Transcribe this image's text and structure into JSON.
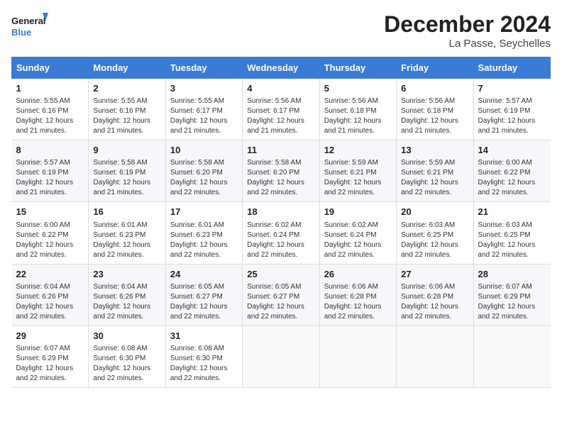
{
  "header": {
    "logo_line1": "General",
    "logo_line2": "Blue",
    "month": "December 2024",
    "location": "La Passe, Seychelles"
  },
  "columns": [
    "Sunday",
    "Monday",
    "Tuesday",
    "Wednesday",
    "Thursday",
    "Friday",
    "Saturday"
  ],
  "weeks": [
    [
      {
        "day": "1",
        "info": "Sunrise: 5:55 AM\nSunset: 6:16 PM\nDaylight: 12 hours\nand 21 minutes."
      },
      {
        "day": "2",
        "info": "Sunrise: 5:55 AM\nSunset: 6:16 PM\nDaylight: 12 hours\nand 21 minutes."
      },
      {
        "day": "3",
        "info": "Sunrise: 5:55 AM\nSunset: 6:17 PM\nDaylight: 12 hours\nand 21 minutes."
      },
      {
        "day": "4",
        "info": "Sunrise: 5:56 AM\nSunset: 6:17 PM\nDaylight: 12 hours\nand 21 minutes."
      },
      {
        "day": "5",
        "info": "Sunrise: 5:56 AM\nSunset: 6:18 PM\nDaylight: 12 hours\nand 21 minutes."
      },
      {
        "day": "6",
        "info": "Sunrise: 5:56 AM\nSunset: 6:18 PM\nDaylight: 12 hours\nand 21 minutes."
      },
      {
        "day": "7",
        "info": "Sunrise: 5:57 AM\nSunset: 6:19 PM\nDaylight: 12 hours\nand 21 minutes."
      }
    ],
    [
      {
        "day": "8",
        "info": "Sunrise: 5:57 AM\nSunset: 6:19 PM\nDaylight: 12 hours\nand 21 minutes."
      },
      {
        "day": "9",
        "info": "Sunrise: 5:58 AM\nSunset: 6:19 PM\nDaylight: 12 hours\nand 21 minutes."
      },
      {
        "day": "10",
        "info": "Sunrise: 5:58 AM\nSunset: 6:20 PM\nDaylight: 12 hours\nand 22 minutes."
      },
      {
        "day": "11",
        "info": "Sunrise: 5:58 AM\nSunset: 6:20 PM\nDaylight: 12 hours\nand 22 minutes."
      },
      {
        "day": "12",
        "info": "Sunrise: 5:59 AM\nSunset: 6:21 PM\nDaylight: 12 hours\nand 22 minutes."
      },
      {
        "day": "13",
        "info": "Sunrise: 5:59 AM\nSunset: 6:21 PM\nDaylight: 12 hours\nand 22 minutes."
      },
      {
        "day": "14",
        "info": "Sunrise: 6:00 AM\nSunset: 6:22 PM\nDaylight: 12 hours\nand 22 minutes."
      }
    ],
    [
      {
        "day": "15",
        "info": "Sunrise: 6:00 AM\nSunset: 6:22 PM\nDaylight: 12 hours\nand 22 minutes."
      },
      {
        "day": "16",
        "info": "Sunrise: 6:01 AM\nSunset: 6:23 PM\nDaylight: 12 hours\nand 22 minutes."
      },
      {
        "day": "17",
        "info": "Sunrise: 6:01 AM\nSunset: 6:23 PM\nDaylight: 12 hours\nand 22 minutes."
      },
      {
        "day": "18",
        "info": "Sunrise: 6:02 AM\nSunset: 6:24 PM\nDaylight: 12 hours\nand 22 minutes."
      },
      {
        "day": "19",
        "info": "Sunrise: 6:02 AM\nSunset: 6:24 PM\nDaylight: 12 hours\nand 22 minutes."
      },
      {
        "day": "20",
        "info": "Sunrise: 6:03 AM\nSunset: 6:25 PM\nDaylight: 12 hours\nand 22 minutes."
      },
      {
        "day": "21",
        "info": "Sunrise: 6:03 AM\nSunset: 6:25 PM\nDaylight: 12 hours\nand 22 minutes."
      }
    ],
    [
      {
        "day": "22",
        "info": "Sunrise: 6:04 AM\nSunset: 6:26 PM\nDaylight: 12 hours\nand 22 minutes."
      },
      {
        "day": "23",
        "info": "Sunrise: 6:04 AM\nSunset: 6:26 PM\nDaylight: 12 hours\nand 22 minutes."
      },
      {
        "day": "24",
        "info": "Sunrise: 6:05 AM\nSunset: 6:27 PM\nDaylight: 12 hours\nand 22 minutes."
      },
      {
        "day": "25",
        "info": "Sunrise: 6:05 AM\nSunset: 6:27 PM\nDaylight: 12 hours\nand 22 minutes."
      },
      {
        "day": "26",
        "info": "Sunrise: 6:06 AM\nSunset: 6:28 PM\nDaylight: 12 hours\nand 22 minutes."
      },
      {
        "day": "27",
        "info": "Sunrise: 6:06 AM\nSunset: 6:28 PM\nDaylight: 12 hours\nand 22 minutes."
      },
      {
        "day": "28",
        "info": "Sunrise: 6:07 AM\nSunset: 6:29 PM\nDaylight: 12 hours\nand 22 minutes."
      }
    ],
    [
      {
        "day": "29",
        "info": "Sunrise: 6:07 AM\nSunset: 6:29 PM\nDaylight: 12 hours\nand 22 minutes."
      },
      {
        "day": "30",
        "info": "Sunrise: 6:08 AM\nSunset: 6:30 PM\nDaylight: 12 hours\nand 22 minutes."
      },
      {
        "day": "31",
        "info": "Sunrise: 6:08 AM\nSunset: 6:30 PM\nDaylight: 12 hours\nand 22 minutes."
      },
      {
        "day": "",
        "info": ""
      },
      {
        "day": "",
        "info": ""
      },
      {
        "day": "",
        "info": ""
      },
      {
        "day": "",
        "info": ""
      }
    ]
  ]
}
